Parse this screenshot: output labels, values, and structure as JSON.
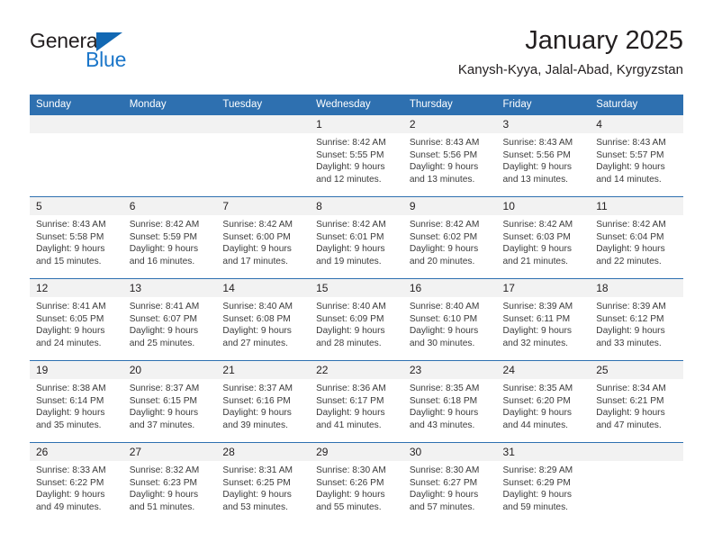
{
  "logo": {
    "word_one": "General",
    "word_two": "Blue",
    "triangle_color": "#1268b3",
    "blue_text_color": "#1b76c9"
  },
  "header": {
    "title": "January 2025",
    "subtitle": "Kanysh-Kyya, Jalal-Abad, Kyrgyzstan"
  },
  "theme": {
    "header_blue": "#2e70b0",
    "daynum_gray": "#f2f2f2",
    "text": "#231f20"
  },
  "weekday_headers": [
    "Sunday",
    "Monday",
    "Tuesday",
    "Wednesday",
    "Thursday",
    "Friday",
    "Saturday"
  ],
  "weeks": [
    [
      {
        "day": "",
        "sunrise": "",
        "sunset": "",
        "daylight_1": "",
        "daylight_2": "",
        "blank": true
      },
      {
        "day": "",
        "sunrise": "",
        "sunset": "",
        "daylight_1": "",
        "daylight_2": "",
        "blank": true
      },
      {
        "day": "",
        "sunrise": "",
        "sunset": "",
        "daylight_1": "",
        "daylight_2": "",
        "blank": true
      },
      {
        "day": "1",
        "sunrise": "Sunrise: 8:42 AM",
        "sunset": "Sunset: 5:55 PM",
        "daylight_1": "Daylight: 9 hours",
        "daylight_2": "and 12 minutes.",
        "blank": false
      },
      {
        "day": "2",
        "sunrise": "Sunrise: 8:43 AM",
        "sunset": "Sunset: 5:56 PM",
        "daylight_1": "Daylight: 9 hours",
        "daylight_2": "and 13 minutes.",
        "blank": false
      },
      {
        "day": "3",
        "sunrise": "Sunrise: 8:43 AM",
        "sunset": "Sunset: 5:56 PM",
        "daylight_1": "Daylight: 9 hours",
        "daylight_2": "and 13 minutes.",
        "blank": false
      },
      {
        "day": "4",
        "sunrise": "Sunrise: 8:43 AM",
        "sunset": "Sunset: 5:57 PM",
        "daylight_1": "Daylight: 9 hours",
        "daylight_2": "and 14 minutes.",
        "blank": false
      }
    ],
    [
      {
        "day": "5",
        "sunrise": "Sunrise: 8:43 AM",
        "sunset": "Sunset: 5:58 PM",
        "daylight_1": "Daylight: 9 hours",
        "daylight_2": "and 15 minutes.",
        "blank": false
      },
      {
        "day": "6",
        "sunrise": "Sunrise: 8:42 AM",
        "sunset": "Sunset: 5:59 PM",
        "daylight_1": "Daylight: 9 hours",
        "daylight_2": "and 16 minutes.",
        "blank": false
      },
      {
        "day": "7",
        "sunrise": "Sunrise: 8:42 AM",
        "sunset": "Sunset: 6:00 PM",
        "daylight_1": "Daylight: 9 hours",
        "daylight_2": "and 17 minutes.",
        "blank": false
      },
      {
        "day": "8",
        "sunrise": "Sunrise: 8:42 AM",
        "sunset": "Sunset: 6:01 PM",
        "daylight_1": "Daylight: 9 hours",
        "daylight_2": "and 19 minutes.",
        "blank": false
      },
      {
        "day": "9",
        "sunrise": "Sunrise: 8:42 AM",
        "sunset": "Sunset: 6:02 PM",
        "daylight_1": "Daylight: 9 hours",
        "daylight_2": "and 20 minutes.",
        "blank": false
      },
      {
        "day": "10",
        "sunrise": "Sunrise: 8:42 AM",
        "sunset": "Sunset: 6:03 PM",
        "daylight_1": "Daylight: 9 hours",
        "daylight_2": "and 21 minutes.",
        "blank": false
      },
      {
        "day": "11",
        "sunrise": "Sunrise: 8:42 AM",
        "sunset": "Sunset: 6:04 PM",
        "daylight_1": "Daylight: 9 hours",
        "daylight_2": "and 22 minutes.",
        "blank": false
      }
    ],
    [
      {
        "day": "12",
        "sunrise": "Sunrise: 8:41 AM",
        "sunset": "Sunset: 6:05 PM",
        "daylight_1": "Daylight: 9 hours",
        "daylight_2": "and 24 minutes.",
        "blank": false
      },
      {
        "day": "13",
        "sunrise": "Sunrise: 8:41 AM",
        "sunset": "Sunset: 6:07 PM",
        "daylight_1": "Daylight: 9 hours",
        "daylight_2": "and 25 minutes.",
        "blank": false
      },
      {
        "day": "14",
        "sunrise": "Sunrise: 8:40 AM",
        "sunset": "Sunset: 6:08 PM",
        "daylight_1": "Daylight: 9 hours",
        "daylight_2": "and 27 minutes.",
        "blank": false
      },
      {
        "day": "15",
        "sunrise": "Sunrise: 8:40 AM",
        "sunset": "Sunset: 6:09 PM",
        "daylight_1": "Daylight: 9 hours",
        "daylight_2": "and 28 minutes.",
        "blank": false
      },
      {
        "day": "16",
        "sunrise": "Sunrise: 8:40 AM",
        "sunset": "Sunset: 6:10 PM",
        "daylight_1": "Daylight: 9 hours",
        "daylight_2": "and 30 minutes.",
        "blank": false
      },
      {
        "day": "17",
        "sunrise": "Sunrise: 8:39 AM",
        "sunset": "Sunset: 6:11 PM",
        "daylight_1": "Daylight: 9 hours",
        "daylight_2": "and 32 minutes.",
        "blank": false
      },
      {
        "day": "18",
        "sunrise": "Sunrise: 8:39 AM",
        "sunset": "Sunset: 6:12 PM",
        "daylight_1": "Daylight: 9 hours",
        "daylight_2": "and 33 minutes.",
        "blank": false
      }
    ],
    [
      {
        "day": "19",
        "sunrise": "Sunrise: 8:38 AM",
        "sunset": "Sunset: 6:14 PM",
        "daylight_1": "Daylight: 9 hours",
        "daylight_2": "and 35 minutes.",
        "blank": false
      },
      {
        "day": "20",
        "sunrise": "Sunrise: 8:37 AM",
        "sunset": "Sunset: 6:15 PM",
        "daylight_1": "Daylight: 9 hours",
        "daylight_2": "and 37 minutes.",
        "blank": false
      },
      {
        "day": "21",
        "sunrise": "Sunrise: 8:37 AM",
        "sunset": "Sunset: 6:16 PM",
        "daylight_1": "Daylight: 9 hours",
        "daylight_2": "and 39 minutes.",
        "blank": false
      },
      {
        "day": "22",
        "sunrise": "Sunrise: 8:36 AM",
        "sunset": "Sunset: 6:17 PM",
        "daylight_1": "Daylight: 9 hours",
        "daylight_2": "and 41 minutes.",
        "blank": false
      },
      {
        "day": "23",
        "sunrise": "Sunrise: 8:35 AM",
        "sunset": "Sunset: 6:18 PM",
        "daylight_1": "Daylight: 9 hours",
        "daylight_2": "and 43 minutes.",
        "blank": false
      },
      {
        "day": "24",
        "sunrise": "Sunrise: 8:35 AM",
        "sunset": "Sunset: 6:20 PM",
        "daylight_1": "Daylight: 9 hours",
        "daylight_2": "and 44 minutes.",
        "blank": false
      },
      {
        "day": "25",
        "sunrise": "Sunrise: 8:34 AM",
        "sunset": "Sunset: 6:21 PM",
        "daylight_1": "Daylight: 9 hours",
        "daylight_2": "and 47 minutes.",
        "blank": false
      }
    ],
    [
      {
        "day": "26",
        "sunrise": "Sunrise: 8:33 AM",
        "sunset": "Sunset: 6:22 PM",
        "daylight_1": "Daylight: 9 hours",
        "daylight_2": "and 49 minutes.",
        "blank": false
      },
      {
        "day": "27",
        "sunrise": "Sunrise: 8:32 AM",
        "sunset": "Sunset: 6:23 PM",
        "daylight_1": "Daylight: 9 hours",
        "daylight_2": "and 51 minutes.",
        "blank": false
      },
      {
        "day": "28",
        "sunrise": "Sunrise: 8:31 AM",
        "sunset": "Sunset: 6:25 PM",
        "daylight_1": "Daylight: 9 hours",
        "daylight_2": "and 53 minutes.",
        "blank": false
      },
      {
        "day": "29",
        "sunrise": "Sunrise: 8:30 AM",
        "sunset": "Sunset: 6:26 PM",
        "daylight_1": "Daylight: 9 hours",
        "daylight_2": "and 55 minutes.",
        "blank": false
      },
      {
        "day": "30",
        "sunrise": "Sunrise: 8:30 AM",
        "sunset": "Sunset: 6:27 PM",
        "daylight_1": "Daylight: 9 hours",
        "daylight_2": "and 57 minutes.",
        "blank": false
      },
      {
        "day": "31",
        "sunrise": "Sunrise: 8:29 AM",
        "sunset": "Sunset: 6:29 PM",
        "daylight_1": "Daylight: 9 hours",
        "daylight_2": "and 59 minutes.",
        "blank": false
      },
      {
        "day": "",
        "sunrise": "",
        "sunset": "",
        "daylight_1": "",
        "daylight_2": "",
        "blank": true
      }
    ]
  ]
}
